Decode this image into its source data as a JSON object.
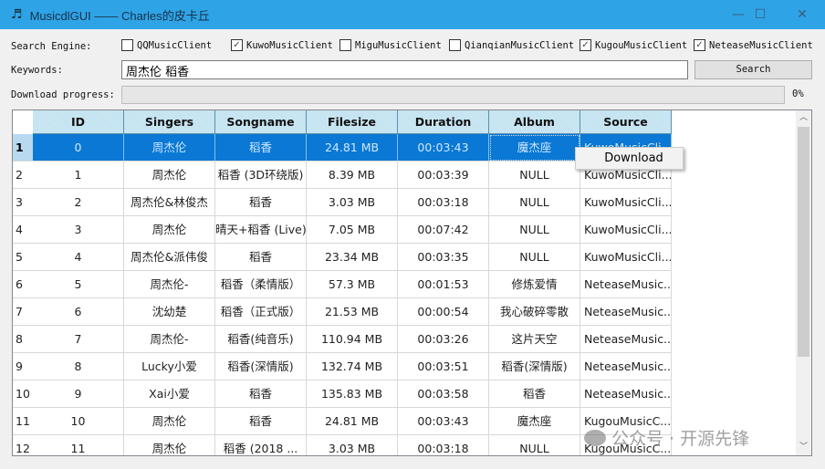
{
  "window": {
    "title": "MusicdlGUI —— Charles的皮卡丘",
    "minimize": "—",
    "maximize": "☐",
    "close": "✕"
  },
  "search_engine": {
    "label": "Search Engine:",
    "options": [
      {
        "name": "QQMusicClient",
        "checked": false
      },
      {
        "name": "KuwoMusicClient",
        "checked": true
      },
      {
        "name": "MiguMusicClient",
        "checked": false
      },
      {
        "name": "QianqianMusicClient",
        "checked": false
      },
      {
        "name": "KugouMusicClient",
        "checked": true
      },
      {
        "name": "NeteaseMusicClient",
        "checked": true
      }
    ]
  },
  "keywords": {
    "label": "Keywords:",
    "value": "周杰伦 稻香"
  },
  "search_button": "Search",
  "progress": {
    "label": "Download progress:",
    "value": 0,
    "text": "0%"
  },
  "table": {
    "columns": [
      "ID",
      "Singers",
      "Songname",
      "Filesize",
      "Duration",
      "Album",
      "Source"
    ],
    "rows": [
      [
        "1",
        "0",
        "周杰伦",
        "稻香",
        "24.81 MB",
        "00:03:43",
        "魔杰座",
        "KuwoMusicCli..."
      ],
      [
        "2",
        "1",
        "周杰伦",
        "稻香 (3D环绕版)",
        "8.39 MB",
        "00:03:39",
        "NULL",
        "KuwoMusicCli..."
      ],
      [
        "3",
        "2",
        "周杰伦&林俊杰",
        "稻香",
        "3.03 MB",
        "00:03:18",
        "NULL",
        "KuwoMusicCli..."
      ],
      [
        "4",
        "3",
        "周杰伦",
        "晴天+稻香 (Live)",
        "7.05 MB",
        "00:07:42",
        "NULL",
        "KuwoMusicCli..."
      ],
      [
        "5",
        "4",
        "周杰伦&派伟俊",
        "稻香",
        "23.34 MB",
        "00:03:35",
        "NULL",
        "KuwoMusicCli..."
      ],
      [
        "6",
        "5",
        "周杰伦-",
        "稻香（柔情版）",
        "57.3 MB",
        "00:01:53",
        "修炼爱情",
        "NeteaseMusic..."
      ],
      [
        "7",
        "6",
        "沈幼楚",
        "稻香（正式版）",
        "21.53 MB",
        "00:00:54",
        "我心破碎零散",
        "NeteaseMusic..."
      ],
      [
        "8",
        "7",
        "周杰伦-",
        "稻香(纯音乐)",
        "110.94 MB",
        "00:03:26",
        "这片天空",
        "NeteaseMusic..."
      ],
      [
        "9",
        "8",
        "Lucky小爱",
        "稻香(深情版)",
        "132.74 MB",
        "00:03:51",
        "稻香(深情版)",
        "NeteaseMusic..."
      ],
      [
        "10",
        "9",
        "Xai小爱",
        "稻香",
        "135.83 MB",
        "00:03:58",
        "稻香",
        "NeteaseMusic..."
      ],
      [
        "11",
        "10",
        "周杰伦",
        "稻香",
        "24.81 MB",
        "00:03:43",
        "魔杰座",
        "KugouMusicC..."
      ],
      [
        "12",
        "11",
        "周杰伦",
        "稻香 (2018 ...",
        "3.03 MB",
        "00:03:18",
        "NULL",
        "KugouMusicC..."
      ]
    ]
  },
  "context_menu": {
    "items": [
      "Download"
    ]
  },
  "watermark": "公众号 · 开源先锋"
}
